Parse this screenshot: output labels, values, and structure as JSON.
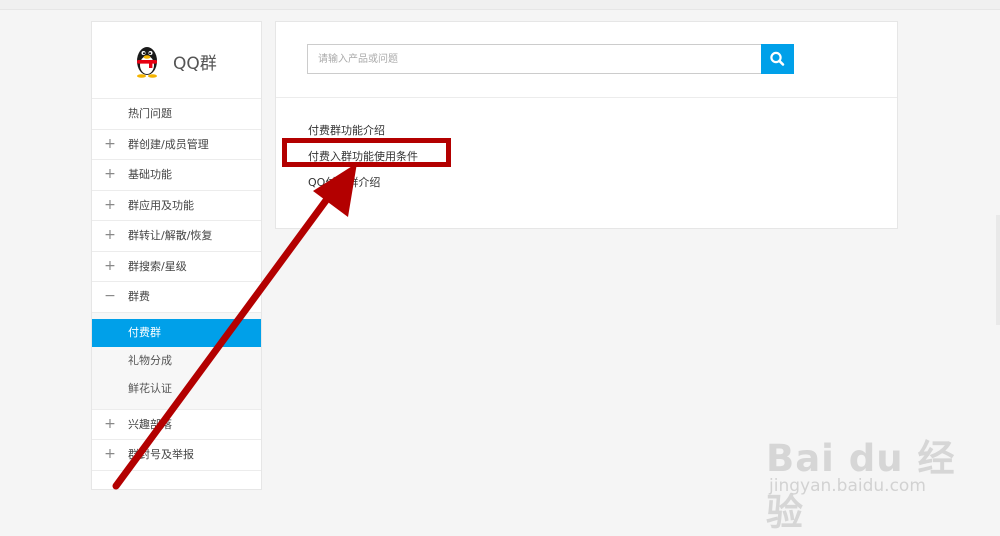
{
  "brand": {
    "name": "QQ群"
  },
  "search": {
    "placeholder": "请输入产品或问题"
  },
  "sidebar": {
    "hot_label": "热门问题",
    "items": [
      {
        "sign": "+",
        "label": "群创建/成员管理"
      },
      {
        "sign": "+",
        "label": "基础功能"
      },
      {
        "sign": "+",
        "label": "群应用及功能"
      },
      {
        "sign": "+",
        "label": "群转让/解散/恢复"
      },
      {
        "sign": "+",
        "label": "群搜索/星级"
      },
      {
        "sign": "−",
        "label": "群费"
      }
    ],
    "subitems": [
      {
        "label": "付费群",
        "active": true
      },
      {
        "label": "礼物分成",
        "active": false
      },
      {
        "label": "鲜花认证",
        "active": false
      }
    ],
    "items_after": [
      {
        "sign": "+",
        "label": "兴趣部落"
      },
      {
        "sign": "+",
        "label": "群封号及举报"
      }
    ]
  },
  "main": {
    "links": [
      "付费群功能介绍",
      "付费入群功能使用条件",
      "QQ付费群介绍"
    ]
  },
  "watermark": {
    "main": "Bai du 经验",
    "sub": "jingyan.baidu.com"
  },
  "colors": {
    "accent": "#00a0e9",
    "annotation": "#b30000"
  },
  "icons": {
    "search": "search-icon",
    "logo": "qq-penguin-icon"
  }
}
